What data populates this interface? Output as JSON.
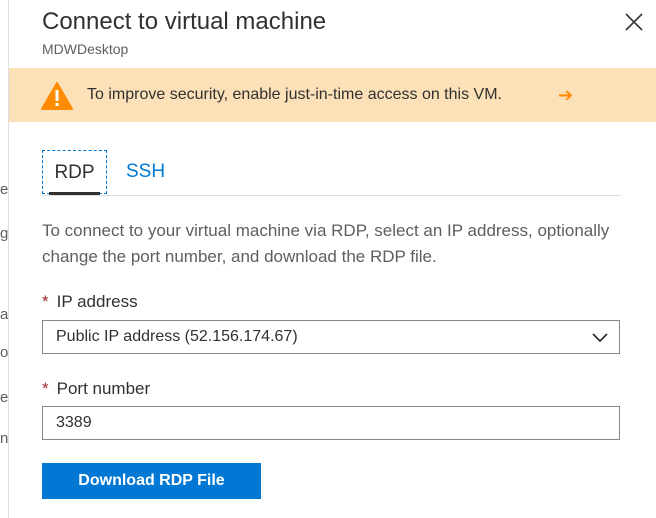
{
  "background_peek": [
    "er",
    "g",
    "a",
    "o",
    "e",
    "n"
  ],
  "header": {
    "title": "Connect to virtual machine",
    "subtitle": "MDWDesktop"
  },
  "banner": {
    "text": "To improve security, enable just-in-time access on this VM.",
    "arrow": "➔",
    "color": "#fce1b8"
  },
  "tabs": [
    {
      "label": "RDP",
      "selected": true
    },
    {
      "label": "SSH",
      "selected": false
    }
  ],
  "description": "To connect to your virtual machine via RDP, select an IP address, optionally change the port number, and download the RDP file.",
  "ip_field": {
    "required_mark": "*",
    "label": "IP address",
    "value": "Public IP address (52.156.174.67)"
  },
  "port_field": {
    "required_mark": "*",
    "label": "Port number",
    "value": "3389"
  },
  "download_button": {
    "label": "Download RDP File",
    "color": "#0078d4"
  },
  "icons": {
    "close": "close-icon",
    "warning": "warning-icon",
    "chevron": "chevron-down-icon"
  }
}
